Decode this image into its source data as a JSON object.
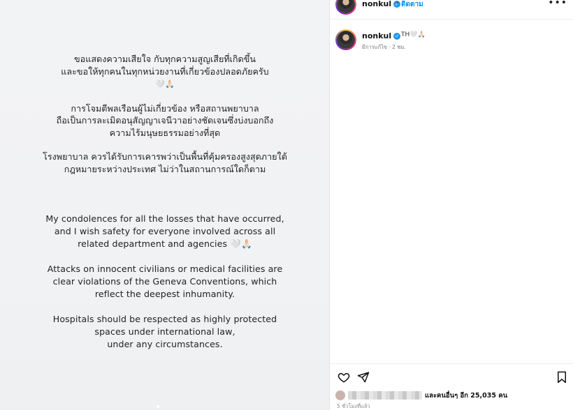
{
  "post": {
    "thai_lines": [
      "ขอแสดงความเสียใจ กับทุกความสูญเสียที่เกิดขึ้น",
      "และขอให้ทุกคนในทุกหน่วยงานที่เกี่ยวข้องปลอดภัยครับ",
      "🤍🙏🏻",
      "การโจมตีพลเรือนผู้ไม่เกี่ยวข้อง หรือสถานพยาบาล",
      "ถือเป็นการละเมิดอนุสัญญาเจนีวาอย่างชัดเจนซึ่งบ่งบอกถึง",
      "ความไร้มนุษยธรรมอย่างที่สุด",
      "โรงพยาบาล ควรได้รับการเคารพว่าเป็นพื้นที่คุ้มครองสูงสุดภายใต้",
      "กฎหมายระหว่างประเทศ ไม่ว่าในสถานการณ์ใดก็ตาม"
    ],
    "en_lines": [
      "My condolences for all the losses that have occurred,",
      "and I wish safety for everyone involved across all",
      "related department and agencies 🤍🙏🏻",
      "Attacks on innocent civilians or medical facilities are",
      "clear violations of the Geneva Conventions, which",
      "reflect the deepest inhumanity.",
      "Hospitals should be respected as highly protected",
      "spaces under international law,",
      "under any circumstances."
    ]
  },
  "header": {
    "username": "nonkul",
    "separator": "•",
    "follow_label": "ติดตาม",
    "more_icon": "more-icon"
  },
  "caption": {
    "username": "nonkul",
    "extra": "TH🤍🙏🏻",
    "meta": "มีการแก้ไข · 2 ชม."
  },
  "actions": {
    "heart_icon": "heart-icon",
    "share_icon": "send-icon",
    "bookmark_icon": "bookmark-icon"
  },
  "likes": {
    "text": "และคนอื่นๆ อีก 25,035 คน"
  },
  "time_ago": "5 ชั่วโมงที่แล้ว",
  "colors": {
    "accent": "#0095f6",
    "verified": "#1d9bf0"
  }
}
